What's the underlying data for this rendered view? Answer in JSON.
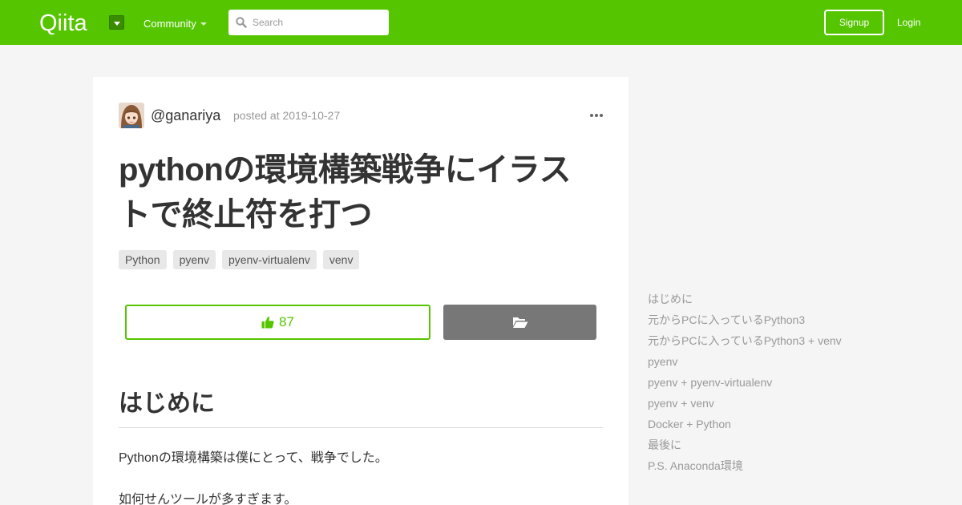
{
  "header": {
    "logo_text": "Qiita",
    "community_label": "Community",
    "search": {
      "placeholder": "Search",
      "icon": "search-icon"
    },
    "signup_label": "Signup",
    "login_label": "Login",
    "brand_color": "#55c500"
  },
  "article": {
    "author": "@ganariya",
    "posted": "posted at 2019-10-27",
    "title": "pythonの環境構築戦争にイラストで終止符を打つ",
    "tags": [
      "Python",
      "pyenv",
      "pyenv-virtualenv",
      "venv"
    ],
    "like_count": "87",
    "like_icon": "thumbs-up-icon",
    "stock_icon": "folder-open-icon",
    "section_heading": "はじめに",
    "paragraphs": [
      "Pythonの環境構築は僕にとって、戦争でした。",
      "如何せんツールが多すぎます。"
    ]
  },
  "toc": {
    "items": [
      "はじめに",
      "元からPCに入っているPython3",
      "元からPCに入っているPython3 + venv",
      "pyenv",
      "pyenv + pyenv-virtualenv",
      "pyenv + venv",
      "Docker + Python",
      "最後に",
      "P.S. Anaconda環境"
    ]
  }
}
